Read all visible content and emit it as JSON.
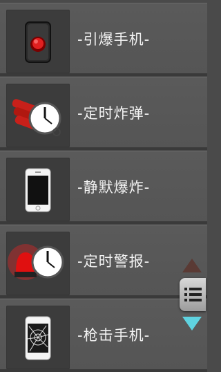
{
  "list": {
    "items": [
      {
        "label": "-引爆手机-",
        "icon": "red-button-icon"
      },
      {
        "label": "-定时炸弹-",
        "icon": "time-bomb-icon"
      },
      {
        "label": "-静默爆炸-",
        "icon": "phone-icon"
      },
      {
        "label": "-定时警报-",
        "icon": "alarm-clock-icon"
      },
      {
        "label": "-枪击手机-",
        "icon": "shattered-phone-icon"
      }
    ]
  },
  "scroll_controls": {
    "up": "triangle-up-icon",
    "menu": "list-icon",
    "down": "triangle-down-icon"
  },
  "colors": {
    "background": "#4a4a4a",
    "row": "#555555",
    "text": "#f2f2f2",
    "down_arrow": "#5fd3e0",
    "up_arrow": "#5a3a34"
  }
}
